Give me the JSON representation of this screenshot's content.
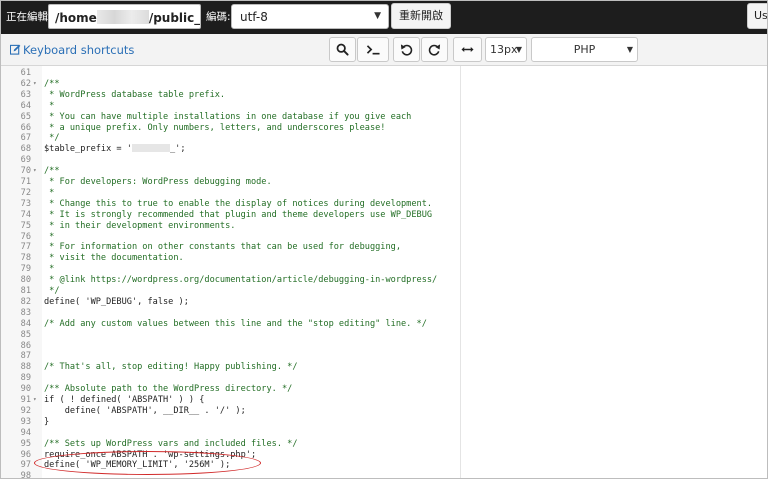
{
  "topbar": {
    "editing_label": "正在編輯:",
    "path_start": "/home",
    "path_end": "/public_ht",
    "encoding_label": "編碼:",
    "encoding_value": "utf-8",
    "reopen_label": "重新開啟",
    "right_label": "Us"
  },
  "toolbar": {
    "shortcuts_label": "Keyboard shortcuts",
    "font_size": "13px",
    "mode": "PHP"
  },
  "editor": {
    "lines": [
      {
        "n": "61",
        "fold": "",
        "text": ""
      },
      {
        "n": "62",
        "fold": "▾",
        "text": "/**"
      },
      {
        "n": "63",
        "fold": "",
        "text": " * WordPress database table prefix."
      },
      {
        "n": "64",
        "fold": "",
        "text": " *"
      },
      {
        "n": "65",
        "fold": "",
        "text": " * You can have multiple installations in one database if you give each"
      },
      {
        "n": "66",
        "fold": "",
        "text": " * a unique prefix. Only numbers, letters, and underscores please!"
      },
      {
        "n": "67",
        "fold": "",
        "text": " */"
      },
      {
        "n": "68",
        "fold": "",
        "text": "$table_prefix = '"
      },
      {
        "n": "69",
        "fold": "",
        "text": ""
      },
      {
        "n": "70",
        "fold": "▾",
        "text": "/**"
      },
      {
        "n": "71",
        "fold": "",
        "text": " * For developers: WordPress debugging mode."
      },
      {
        "n": "72",
        "fold": "",
        "text": " *"
      },
      {
        "n": "73",
        "fold": "",
        "text": " * Change this to true to enable the display of notices during development."
      },
      {
        "n": "74",
        "fold": "",
        "text": " * It is strongly recommended that plugin and theme developers use WP_DEBUG"
      },
      {
        "n": "75",
        "fold": "",
        "text": " * in their development environments."
      },
      {
        "n": "76",
        "fold": "",
        "text": " *"
      },
      {
        "n": "77",
        "fold": "",
        "text": " * For information on other constants that can be used for debugging,"
      },
      {
        "n": "78",
        "fold": "",
        "text": " * visit the documentation."
      },
      {
        "n": "79",
        "fold": "",
        "text": " *"
      },
      {
        "n": "80",
        "fold": "",
        "text": " * @link https://wordpress.org/documentation/article/debugging-in-wordpress/"
      },
      {
        "n": "81",
        "fold": "",
        "text": " */"
      },
      {
        "n": "82",
        "fold": "",
        "text": "define( 'WP_DEBUG', false );"
      },
      {
        "n": "83",
        "fold": "",
        "text": ""
      },
      {
        "n": "84",
        "fold": "",
        "text": "/* Add any custom values between this line and the \"stop editing\" line. */"
      },
      {
        "n": "85",
        "fold": "",
        "text": ""
      },
      {
        "n": "86",
        "fold": "",
        "text": ""
      },
      {
        "n": "87",
        "fold": "",
        "text": ""
      },
      {
        "n": "88",
        "fold": "",
        "text": "/* That's all, stop editing! Happy publishing. */"
      },
      {
        "n": "89",
        "fold": "",
        "text": ""
      },
      {
        "n": "90",
        "fold": "",
        "text": "/** Absolute path to the WordPress directory. */"
      },
      {
        "n": "91",
        "fold": "▾",
        "text": "if ( ! defined( 'ABSPATH' ) ) {"
      },
      {
        "n": "92",
        "fold": "",
        "text": "    define( 'ABSPATH', __DIR__ . '/' );"
      },
      {
        "n": "93",
        "fold": "",
        "text": "}"
      },
      {
        "n": "94",
        "fold": "",
        "text": ""
      },
      {
        "n": "95",
        "fold": "",
        "text": "/** Sets up WordPress vars and included files. */"
      },
      {
        "n": "96",
        "fold": "",
        "text": "require_once ABSPATH . 'wp-settings.php';"
      },
      {
        "n": "97",
        "fold": "",
        "text": "define( 'WP_MEMORY_LIMIT', '256M' );"
      },
      {
        "n": "98",
        "fold": "",
        "text": ""
      }
    ],
    "table_prefix_tail": "_';"
  },
  "colors": {
    "comment": "#236e25",
    "highlight": "#d12a2a",
    "link": "#2a6fb6"
  }
}
